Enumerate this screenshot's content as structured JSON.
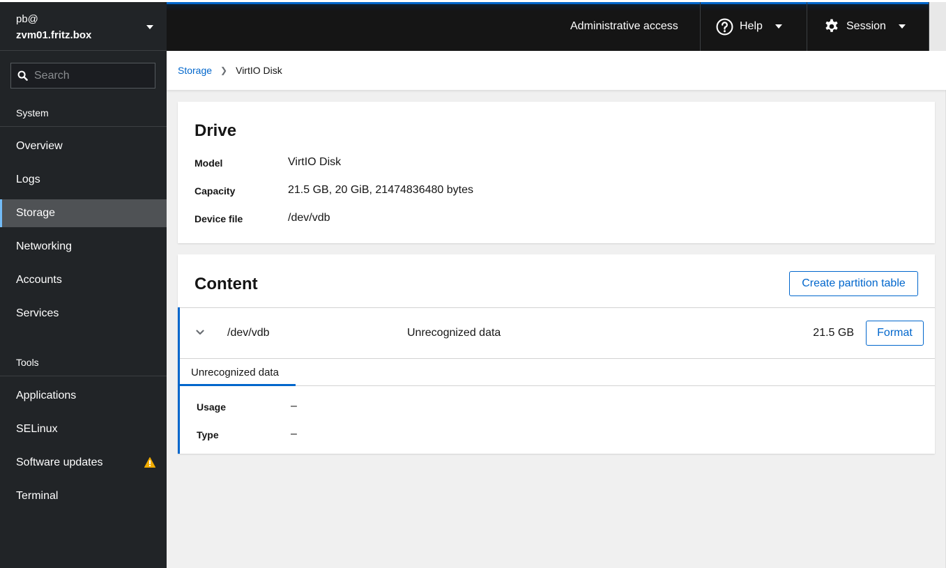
{
  "sidebar": {
    "user": "pb@",
    "hostname": "zvm01.fritz.box",
    "search_placeholder": "Search",
    "sections": [
      {
        "title": "System",
        "items": [
          {
            "label": "Overview"
          },
          {
            "label": "Logs"
          },
          {
            "label": "Storage",
            "active": true
          },
          {
            "label": "Networking"
          },
          {
            "label": "Accounts"
          },
          {
            "label": "Services"
          }
        ]
      },
      {
        "title": "Tools",
        "items": [
          {
            "label": "Applications"
          },
          {
            "label": "SELinux"
          },
          {
            "label": "Software updates",
            "badge": "warning-icon"
          },
          {
            "label": "Terminal"
          }
        ]
      }
    ]
  },
  "masthead": {
    "admin_access": "Administrative access",
    "help": "Help",
    "session": "Session"
  },
  "breadcrumb": {
    "parent": "Storage",
    "current": "VirtIO Disk"
  },
  "drive": {
    "title": "Drive",
    "fields": [
      {
        "label": "Model",
        "value": "VirtIO Disk"
      },
      {
        "label": "Capacity",
        "value": "21.5 GB, 20 GiB, 21474836480 bytes"
      },
      {
        "label": "Device file",
        "value": "/dev/vdb"
      }
    ]
  },
  "content": {
    "title": "Content",
    "create_partition_table": "Create partition table",
    "row": {
      "device": "/dev/vdb",
      "description": "Unrecognized data",
      "size": "21.5 GB",
      "format_label": "Format"
    },
    "tab": "Unrecognized data",
    "details": [
      {
        "label": "Usage",
        "value": "–"
      },
      {
        "label": "Type",
        "value": "–"
      }
    ]
  },
  "colors": {
    "accent": "#0066cc",
    "sidebar_bg": "#212427",
    "masthead_bg": "#151515",
    "active_item_bg": "#4f5255",
    "active_indicator": "#73bcf7",
    "warning": "#f0ab00"
  }
}
